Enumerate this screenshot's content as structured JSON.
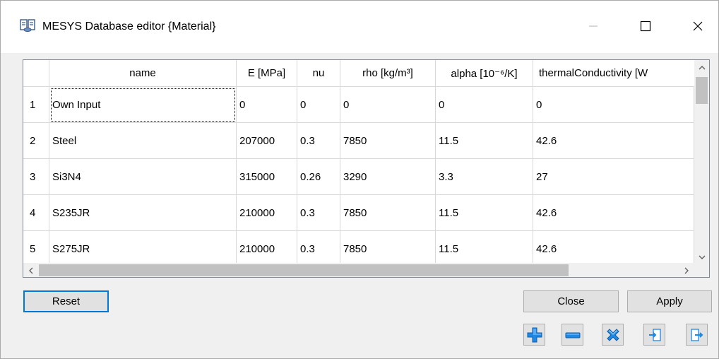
{
  "window": {
    "title": "MESYS Database editor {Material}",
    "icon": "database-icon",
    "controls": {
      "minimize": "minimize-icon",
      "maximize": "maximize-icon",
      "close": "close-icon"
    }
  },
  "table": {
    "columns": [
      "name",
      "E [MPa]",
      "nu",
      "rho [kg/m³]",
      "alpha [10⁻⁶/K]",
      "thermalConductivity [W"
    ],
    "rows": [
      {
        "num": "1",
        "cells": [
          "Own Input",
          "0",
          "0",
          "0",
          "0",
          "0"
        ]
      },
      {
        "num": "2",
        "cells": [
          "Steel",
          "207000",
          "0.3",
          "7850",
          "11.5",
          "42.6"
        ]
      },
      {
        "num": "3",
        "cells": [
          "Si3N4",
          "315000",
          "0.26",
          "3290",
          "3.3",
          "27"
        ]
      },
      {
        "num": "4",
        "cells": [
          "S235JR",
          "210000",
          "0.3",
          "7850",
          "11.5",
          "42.6"
        ]
      },
      {
        "num": "5",
        "cells": [
          "S275JR",
          "210000",
          "0.3",
          "7850",
          "11.5",
          "42.6"
        ]
      }
    ],
    "focused_cell": "Own Input"
  },
  "buttons": {
    "reset": "Reset",
    "close": "Close",
    "apply": "Apply"
  },
  "icon_buttons": [
    "add-row-icon",
    "remove-row-icon",
    "delete-icon",
    "import-icon",
    "export-icon"
  ],
  "colors": {
    "focus_border": "#0078d7",
    "icon_blue": "#1e88e5",
    "grid_line": "#d8d8d8"
  }
}
